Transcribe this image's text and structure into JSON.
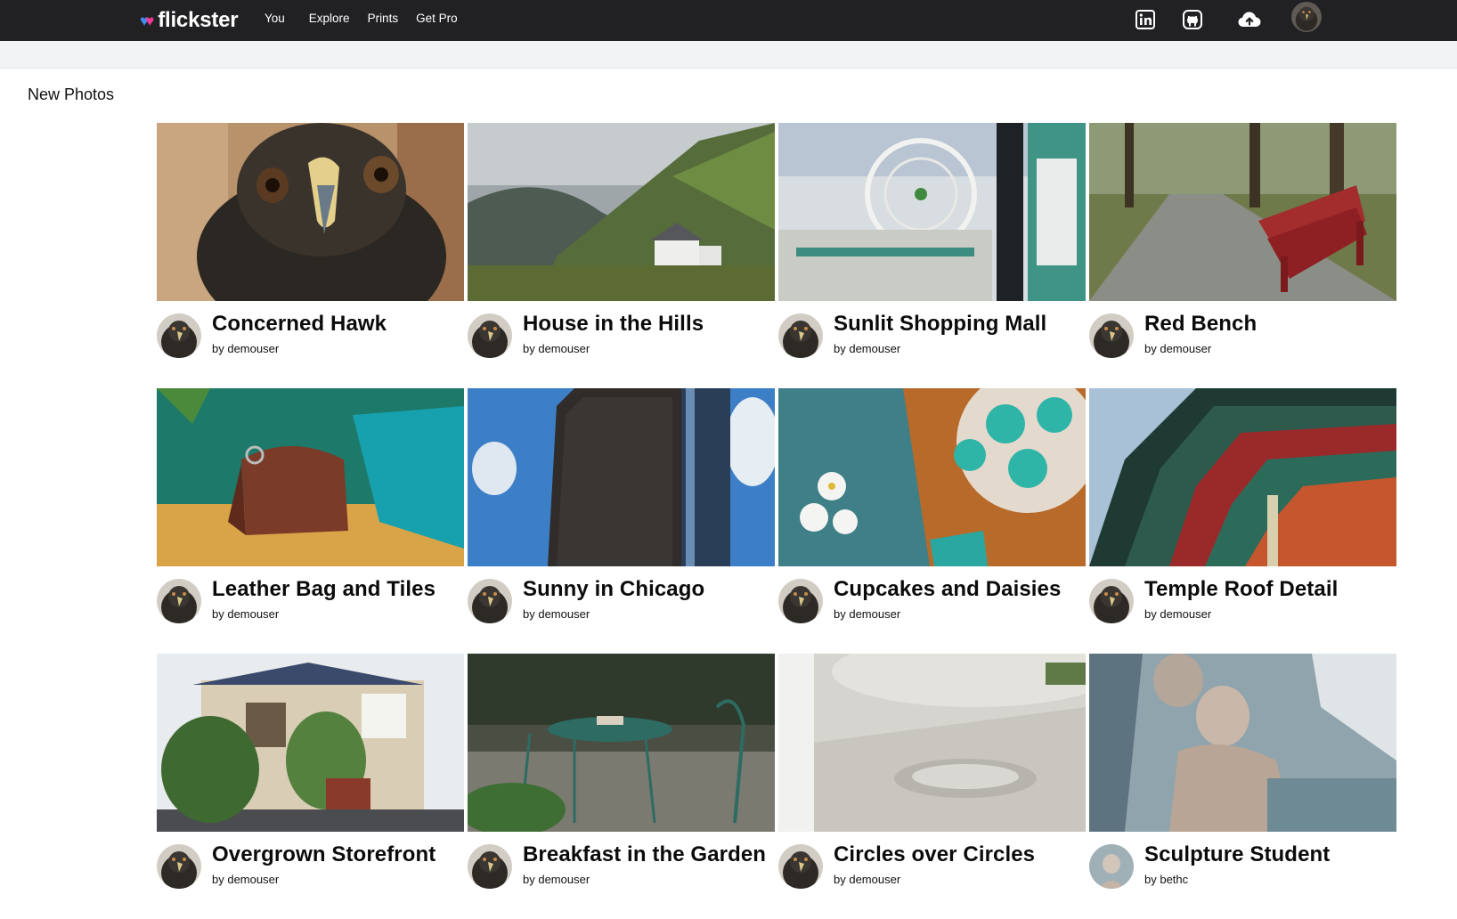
{
  "header": {
    "logo_text": "flickster",
    "nav": [
      "You",
      "Explore",
      "Prints",
      "Get Pro"
    ],
    "icons": [
      "linkedin-icon",
      "github-icon",
      "cloud-upload-icon"
    ]
  },
  "section_title": "New Photos",
  "photos": [
    {
      "title": "Concerned Hawk",
      "byline": "by demouser",
      "owner": "demouser"
    },
    {
      "title": "House in the Hills",
      "byline": "by demouser",
      "owner": "demouser"
    },
    {
      "title": "Sunlit Shopping Mall",
      "byline": "by demouser",
      "owner": "demouser"
    },
    {
      "title": "Red Bench",
      "byline": "by demouser",
      "owner": "demouser"
    },
    {
      "title": "Leather Bag and Tiles",
      "byline": "by demouser",
      "owner": "demouser"
    },
    {
      "title": "Sunny in Chicago",
      "byline": "by demouser",
      "owner": "demouser"
    },
    {
      "title": "Cupcakes and Daisies",
      "byline": "by demouser",
      "owner": "demouser"
    },
    {
      "title": "Temple Roof Detail",
      "byline": "by demouser",
      "owner": "demouser"
    },
    {
      "title": "Overgrown Storefront",
      "byline": "by demouser",
      "owner": "demouser"
    },
    {
      "title": "Breakfast in the Garden",
      "byline": "by demouser",
      "owner": "demouser"
    },
    {
      "title": "Circles over Circles",
      "byline": "by demouser",
      "owner": "demouser"
    },
    {
      "title": "Sculpture Student",
      "byline": "by bethc",
      "owner": "bethc"
    }
  ],
  "colors": {
    "topbar": "#212124",
    "subbar": "#f2f3f5",
    "logo_blue": "#3d8cf6",
    "logo_pink": "#f23a93"
  }
}
